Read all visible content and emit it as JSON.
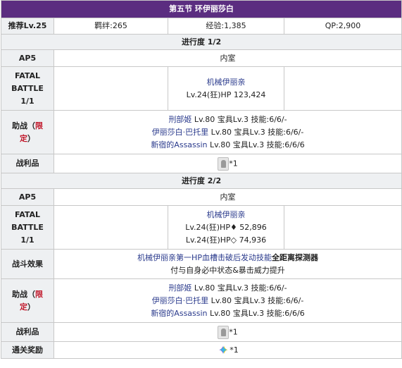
{
  "title": "第五节 环伊丽莎白",
  "info": {
    "recommend": "推荐Lv.25",
    "bond": "羁绊:265",
    "exp": "经验:1,385",
    "qp": "QP:2,900"
  },
  "progress1": {
    "label": "进行度 1/2",
    "ap_label": "AP5",
    "location": "内室",
    "fatal_line1": "FATAL",
    "fatal_line2": "BATTLE",
    "fatal_line3": "1/1",
    "enemy_name": "机械伊丽亲",
    "enemy_stats": "Lv.24(狂)HP 123,424",
    "support_label_a": "助战（",
    "support_label_b": "限",
    "support_label_c": "定",
    "support_label_d": "）",
    "supports": [
      {
        "name": "刑部姬",
        "info": " Lv.80 宝具Lv.3 技能:6/6/-"
      },
      {
        "name": "伊丽莎白·巴托里",
        "info": " Lv.80 宝具Lv.3 技能:6/6/-"
      },
      {
        "name": "新宿的Assassin",
        "info": " Lv.80 宝具Lv.3 技能:6/6/6"
      }
    ],
    "loot_label": "战利品",
    "loot_qty": "*1"
  },
  "progress2": {
    "label": "进行度 2/2",
    "ap_label": "AP5",
    "location": "内室",
    "fatal_line1": "FATAL",
    "fatal_line2": "BATTLE",
    "fatal_line3": "1/1",
    "enemy_name": "机械伊丽亲",
    "enemy_stats_1": "Lv.24(狂)HP♦ 52,896",
    "enemy_stats_2": "Lv.24(狂)HP◇ 74,936",
    "effect_label": "战斗效果",
    "effect_1a": "机械伊丽亲第一HP血槽击破后发动技能",
    "effect_1b": "全距离探测器",
    "effect_2": "付与自身必中状态&暴击威力提升",
    "support_label_a": "助战（",
    "support_label_b": "限",
    "support_label_c": "定",
    "support_label_d": "）",
    "supports": [
      {
        "name": "刑部姬",
        "info": " Lv.80 宝具Lv.3 技能:6/6/-"
      },
      {
        "name": "伊丽莎白·巴托里",
        "info": " Lv.80 宝具Lv.3 技能:6/6/-"
      },
      {
        "name": "新宿的Assassin",
        "info": " Lv.80 宝具Lv.3 技能:6/6/6"
      }
    ],
    "loot_label": "战利品",
    "loot_qty": "*1",
    "reward_label": "通关奖励",
    "reward_qty": "*1"
  },
  "icons": {
    "loot": "statue-item-icon",
    "reward": "saint-quartz-icon"
  },
  "colors": {
    "header": "#5b2d80",
    "label_bg": "#eef0f2",
    "link": "#2a3a8c",
    "limited": "#c0172a"
  }
}
